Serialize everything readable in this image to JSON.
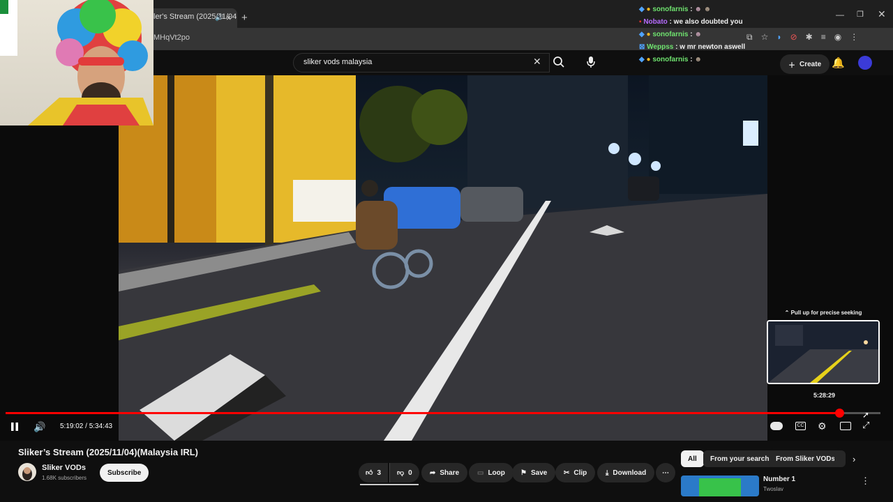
{
  "browser": {
    "tab_title": "ler's Stream (2025/11/04",
    "url": "MHqVt2po"
  },
  "youtube": {
    "search_value": "sliker vods malaysia",
    "create_label": "Create"
  },
  "chat": [
    {
      "user": "sonofarnis",
      "color": "#6fe36f",
      "text": ""
    },
    {
      "user": "Nobato",
      "color": "#b76bff",
      "text": "we also doubted you"
    },
    {
      "user": "sonofarnis",
      "color": "#6fe36f",
      "text": ""
    },
    {
      "user": "Weppss",
      "color": "#6fe36f",
      "text": "w mr newton aswell"
    },
    {
      "user": "sonofarnis",
      "color": "#6fe36f",
      "text": ""
    }
  ],
  "player": {
    "current_time": "5:19:02",
    "separator": " / ",
    "duration": "5:34:43",
    "progress_fraction": 0.953,
    "seek_hint": "Pull up for precise seeking",
    "preview_time": "5:28:29"
  },
  "video": {
    "title": "Sliker’s Stream (2025/11/04)(Malaysia IRL)",
    "channel": "Sliker VODs",
    "subscribers": "1.68K subscribers",
    "subscribe_label": "Subscribe",
    "likes": "3",
    "dislikes": "0",
    "share_label": "Share",
    "loop_label": "Loop",
    "save_label": "Save",
    "clip_label": "Clip",
    "download_label": "Download"
  },
  "chips": [
    "All",
    "From your search",
    "From Sliker VODs"
  ],
  "recommended": {
    "title": "Number 1",
    "channel": "Twoslav"
  },
  "colors": {
    "accent": "#ff0000",
    "background": "#0f0f0f"
  }
}
